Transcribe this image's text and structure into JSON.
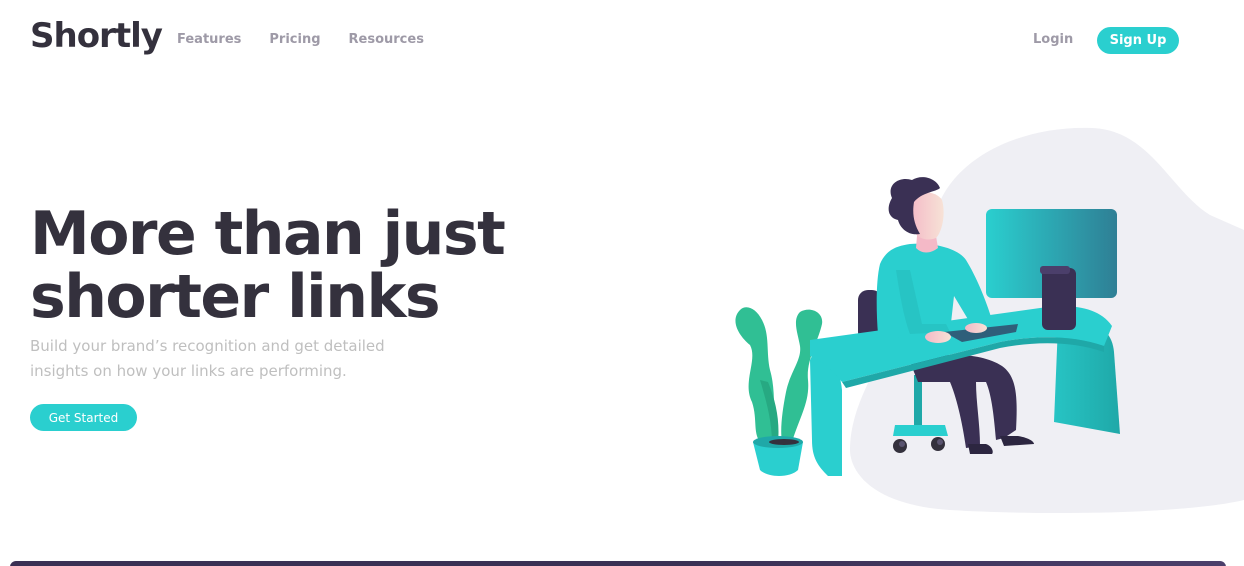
{
  "brand": {
    "logo": "Shortly"
  },
  "nav": {
    "items": [
      "Features",
      "Pricing",
      "Resources"
    ],
    "login": "Login",
    "signup": "Sign Up"
  },
  "hero": {
    "title_line1": "More than just",
    "title_line2": "shorter links",
    "subtitle": "Build your brand’s recognition and get detailed insights on how your links are performing.",
    "cta": "Get Started",
    "illustration_icon": "person-working-at-desk-illustration"
  },
  "colors": {
    "accent": "#2acfcf",
    "dark": "#34313d",
    "gray": "#9e9aa7",
    "light_text": "#bfbfbf",
    "blob": "#efeff4",
    "violet": "#3a3054"
  }
}
